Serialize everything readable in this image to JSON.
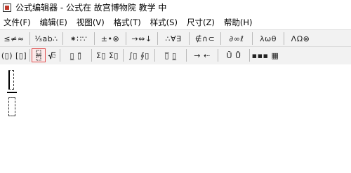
{
  "window": {
    "title": "公式编辑器 - 公式在 故宫博物院 教学 中"
  },
  "menu": [
    "文件(F)",
    "编辑(E)",
    "视图(V)",
    "格式(T)",
    "样式(S)",
    "尺寸(Z)",
    "帮助(H)"
  ],
  "toolbar": {
    "row1": [
      "≤≠≈",
      "⅓ab∴",
      "⁕∷∵",
      "±•⊗",
      "→⇔↓",
      "∴∀∃",
      "∉∩⊂",
      "∂∞ℓ",
      "λωθ",
      "ΛΩ⊗"
    ],
    "row2": [
      "(▯) [▯]",
      "▯⁄▯ √▯",
      "▯̲ ▯̄",
      "Σ▯ Σ▯",
      "∫▯ ∮▯",
      "▯̅ ▯̲",
      "→ ⇠",
      "Ū̇ Ů",
      "▪▪▪ ▦"
    ],
    "selected_button": "fraction-template"
  }
}
